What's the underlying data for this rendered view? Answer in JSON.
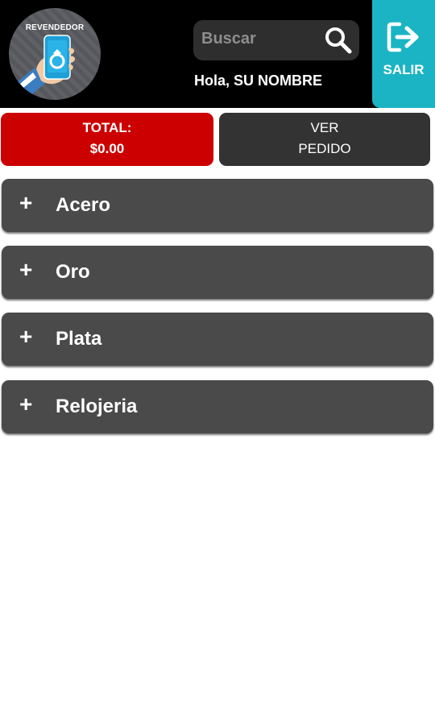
{
  "header": {
    "logo_text": "REVENDEDOR",
    "search_placeholder": "Buscar",
    "greeting": "Hola, SU NOMBRE",
    "exit_label": "SALIR"
  },
  "summary": {
    "total_label": "TOTAL:",
    "total_value": "$0.00",
    "order_line1": "VER",
    "order_line2": "PEDIDO"
  },
  "categories": [
    {
      "label": "Acero",
      "icon": "plus-icon"
    },
    {
      "label": "Oro",
      "icon": "plus-icon"
    },
    {
      "label": "Plata",
      "icon": "plus-icon"
    },
    {
      "label": "Relojeria",
      "icon": "plus-icon"
    }
  ],
  "colors": {
    "header_bg": "#000000",
    "exit_accent": "#1bb4c4",
    "total_red": "#cc0000",
    "order_dark": "#333333",
    "category_gray": "#4a4a4a"
  }
}
